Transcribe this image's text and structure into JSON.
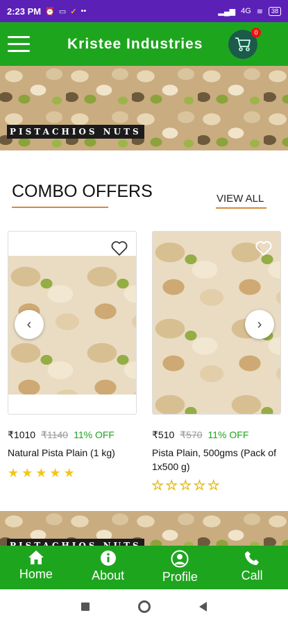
{
  "status": {
    "time": "2:23 PM",
    "battery": "38",
    "network": "4G"
  },
  "header": {
    "title": "Kristee Industries",
    "cart_count": "0"
  },
  "banner": {
    "label": "PISTACHIOS NUTS"
  },
  "section": {
    "title": "COMBO OFFERS",
    "view_all": "VIEW ALL"
  },
  "products": [
    {
      "price": "₹1010",
      "old_price": "₹1140",
      "discount": "11% OFF",
      "name": "Natural Pista Plain (1 kg)",
      "rating": 5
    },
    {
      "price": "₹510",
      "old_price": "₹570",
      "discount": "11% OFF",
      "name": "Pista Plain, 500gms (Pack of 1x500 g)",
      "rating": 0
    }
  ],
  "bottom_nav": [
    {
      "label": "Home",
      "icon": "home-icon"
    },
    {
      "label": "About",
      "icon": "info-icon"
    },
    {
      "label": "Profile",
      "icon": "profile-icon"
    },
    {
      "label": "Call",
      "icon": "phone-icon"
    }
  ],
  "colors": {
    "status_bar": "#5b21b6",
    "brand_green": "#1ea51e",
    "accent_orange": "#d78a3a",
    "cart_circle": "#1c5a4a",
    "star_yellow": "#f5c518"
  }
}
